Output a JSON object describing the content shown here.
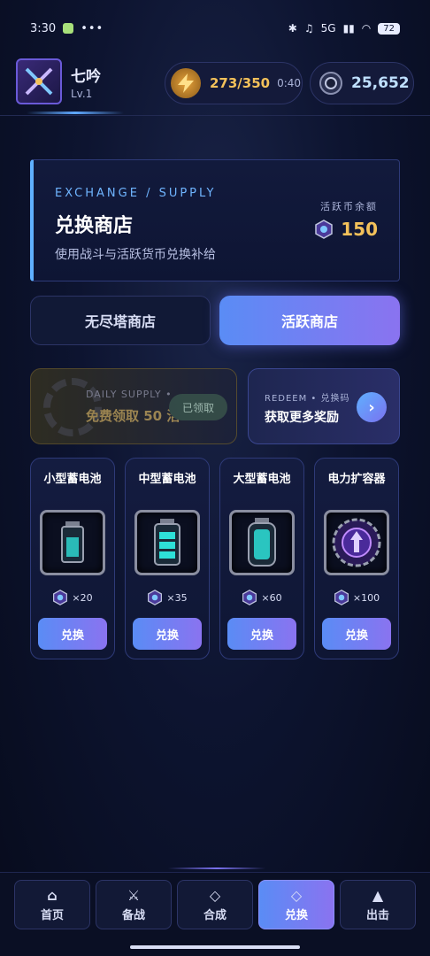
{
  "status": {
    "time": "3:30",
    "dots": "•••",
    "signal": "5G",
    "battery": "72"
  },
  "profile": {
    "name": "七吟",
    "level": "Lv.1"
  },
  "energy": {
    "value": "273/350",
    "timer": "0:40"
  },
  "coins": {
    "value": "25,652"
  },
  "exchange": {
    "tag": "EXCHANGE / SUPPLY",
    "title": "兑换商店",
    "subtitle": "使用战斗与活跃货币兑换补给",
    "balance_label": "活跃币余额",
    "balance": "150"
  },
  "tabs": [
    {
      "label": "无尽塔商店",
      "active": false
    },
    {
      "label": "活跃商店",
      "active": true
    }
  ],
  "daily": {
    "label": "DAILY SUPPLY • ",
    "main": "免费领取 50 活",
    "status": "已领取"
  },
  "redeem": {
    "label": "REDEEM • 兑换码",
    "main": "获取更多奖励",
    "arrow": "›"
  },
  "items": [
    {
      "name": "小型蓄电池",
      "cost": "×20",
      "button": "兑换",
      "icon": "small-battery-icon"
    },
    {
      "name": "中型蓄电池",
      "cost": "×35",
      "button": "兑换",
      "icon": "medium-battery-icon"
    },
    {
      "name": "大型蓄电池",
      "cost": "×60",
      "button": "兑换",
      "icon": "large-battery-icon"
    },
    {
      "name": "电力扩容器",
      "cost": "×100",
      "button": "兑换",
      "icon": "power-expander-icon"
    }
  ],
  "nav": [
    {
      "label": "首页",
      "icon": "⌂",
      "active": false
    },
    {
      "label": "备战",
      "icon": "⚔",
      "active": false
    },
    {
      "label": "合成",
      "icon": "◇",
      "active": false
    },
    {
      "label": "兑换",
      "icon": "◇",
      "active": true
    },
    {
      "label": "出击",
      "icon": "▲",
      "active": false
    }
  ],
  "colors": {
    "accent": "#5fb0ff",
    "gold": "#f3c15a",
    "gradient_start": "#5a8cf5",
    "gradient_end": "#8a73f0"
  }
}
